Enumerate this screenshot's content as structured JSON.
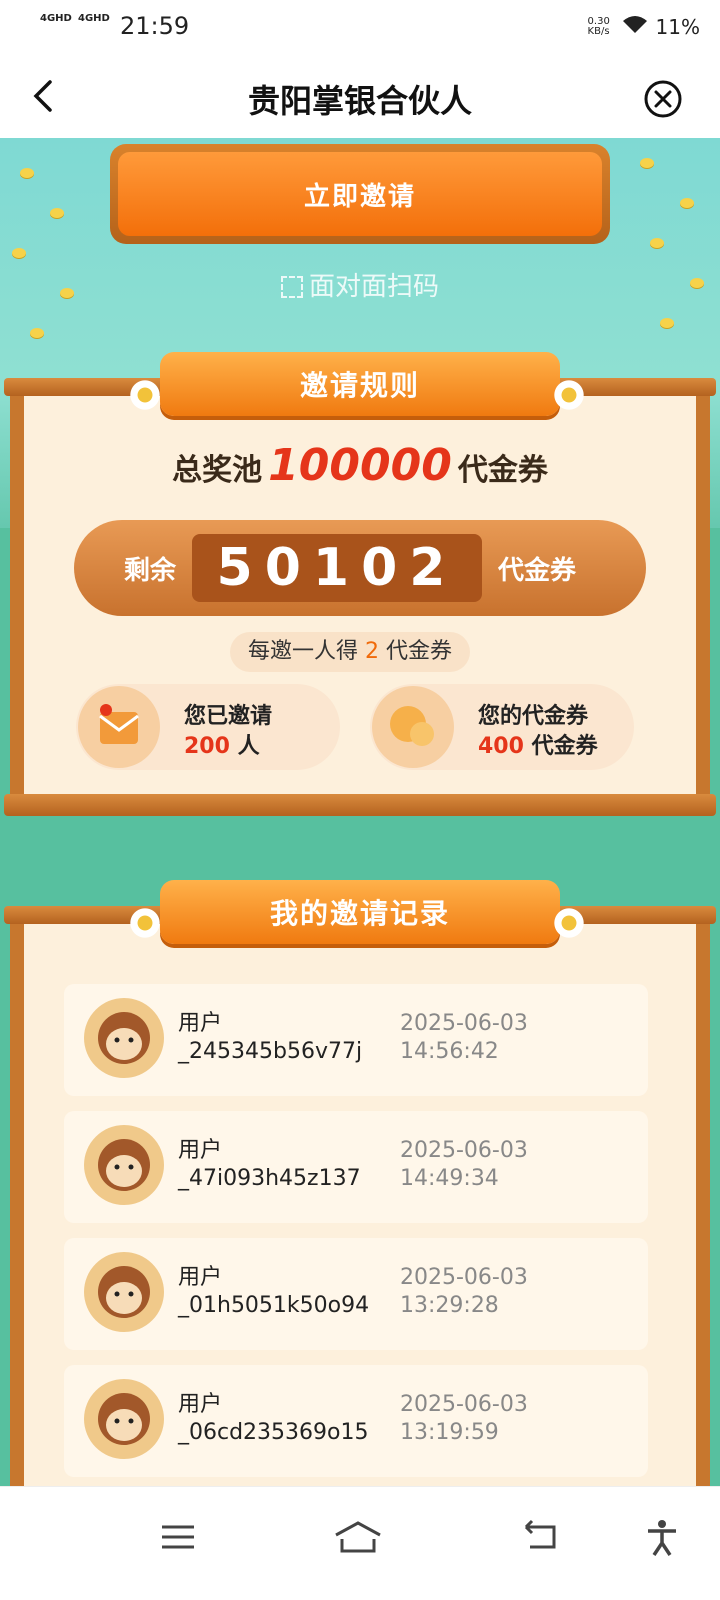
{
  "status": {
    "net1": "4GHD",
    "net2": "4GHD",
    "time": "21:59",
    "speed": "0.30 KB/s",
    "battery": "11%"
  },
  "nav": {
    "title": "贵阳掌银合伙人"
  },
  "actions": {
    "invite_now": "立即邀请",
    "face_scan": "面对面扫码"
  },
  "rules": {
    "title": "邀请规则",
    "pool_prefix": "总奖池",
    "pool_value": "100000",
    "pool_suffix": "代金券",
    "remain_label": "剩余",
    "remain_value": "50102",
    "remain_suffix": "代金券",
    "each_prefix": "每邀一人得",
    "each_value": "2",
    "each_suffix": "代金券",
    "invited_title": "您已邀请",
    "invited_value": "200",
    "invited_unit": "人",
    "coupon_title": "您的代金券",
    "coupon_value": "400",
    "coupon_unit": "代金券"
  },
  "records": {
    "title": "我的邀请记录",
    "items": [
      {
        "name1": "用户",
        "name2": "_245345b56v77j",
        "date": "2025-06-03",
        "time": "14:56:42"
      },
      {
        "name1": "用户",
        "name2": "_47i093h45z137",
        "date": "2025-06-03",
        "time": "14:49:34"
      },
      {
        "name1": "用户",
        "name2": "_01h5051k50o94",
        "date": "2025-06-03",
        "time": "13:29:28"
      },
      {
        "name1": "用户",
        "name2": "_06cd235369o15",
        "date": "2025-06-03",
        "time": "13:19:59"
      }
    ]
  }
}
